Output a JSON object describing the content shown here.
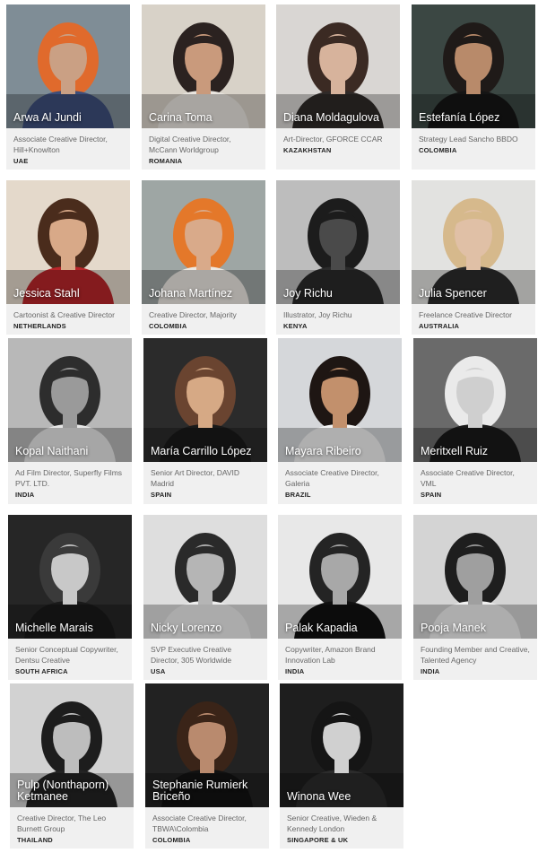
{
  "profiles": [
    {
      "name": "Arwa Al Jundi",
      "role": "Associate Creative Director, Hill+Knowlton",
      "country": "UAE",
      "bg": "#7f8d96",
      "skin": "#caa084",
      "hair": "#e06a2c",
      "shirt": "#3d4e7a"
    },
    {
      "name": "Carina Toma",
      "role": "Digital Creative Director, McCann Worldgroup",
      "country": "ROMANIA",
      "bg": "#d8d2c8",
      "skin": "#c99a7c",
      "hair": "#2b2220",
      "shirt": "#e9e5df"
    },
    {
      "name": "Diana Moldagulova",
      "role": "Art-Director, GFORCE CCAR",
      "country": "KAZAKHSTAN",
      "bg": "#d9d6d3",
      "skin": "#d7b39c",
      "hair": "#3b2a23",
      "shirt": "#2f2a28"
    },
    {
      "name": "Estefanía López",
      "role": "Strategy Lead Sancho BBDO",
      "country": "COLOMBIA",
      "bg": "#3b4743",
      "skin": "#b88a6a",
      "hair": "#1f1a18",
      "shirt": "#151515"
    },
    {
      "name": "Jessica Stahl",
      "role": "Cartoonist & Creative Director",
      "country": "NETHERLANDS",
      "bg": "#e4d9cb",
      "skin": "#d8a988",
      "hair": "#4a2c1c",
      "shirt": "#b8262a"
    },
    {
      "name": "Johana Martínez",
      "role": "Creative Director, Majority",
      "country": "COLOMBIA",
      "bg": "#9ea6a4",
      "skin": "#d9aa8a",
      "hair": "#e4782a",
      "shirt": "#ece8e2"
    },
    {
      "name": "Joy Richu",
      "role": "Illustrator, Joy Richu",
      "country": "KENYA",
      "bg": "#bdbdbd",
      "skin": "#4a4a4a",
      "hair": "#1c1c1c",
      "shirt": "#2a2a2a"
    },
    {
      "name": "Julia Spencer",
      "role": "Freelance Creative Director",
      "country": "AUSTRALIA",
      "bg": "#e2e2e0",
      "skin": "#e0c0a6",
      "hair": "#d6b98c",
      "shirt": "#2b2b2b"
    },
    {
      "name": "Kopal Naithani",
      "role": "Ad Film Director, Superfly Films PVT. LTD.",
      "country": "INDIA",
      "bg": "#b8b8b8",
      "skin": "#9a9a9a",
      "hair": "#2d2d2d",
      "shirt": "#e6e6e6"
    },
    {
      "name": "María Carrillo López",
      "role": "Senior Art Director, DAVID Madrid",
      "country": "SPAIN",
      "bg": "#2b2b2b",
      "skin": "#d6a985",
      "hair": "#6a4430",
      "shirt": "#1a1a1a"
    },
    {
      "name": "Mayara Ribeiro",
      "role": "Associate Creative Director, Galeria",
      "country": "BRAZIL",
      "bg": "#d5d7da",
      "skin": "#c2906c",
      "hair": "#1e1613",
      "shirt": "#f3f3f3"
    },
    {
      "name": "Meritxell Ruiz",
      "role": "Associate Creative Director, VML",
      "country": "SPAIN",
      "bg": "#6a6a6a",
      "skin": "#cfcfcf",
      "hair": "#eaeaea",
      "shirt": "#1a1a1a"
    },
    {
      "name": "Michelle Marais",
      "role": "Senior Conceptual Copywriter, Dentsu Creative",
      "country": "SOUTH AFRICA",
      "bg": "#262626",
      "skin": "#c8c8c8",
      "hair": "#3a3a3a",
      "shirt": "#1a1a1a"
    },
    {
      "name": "Nicky Lorenzo",
      "role": "SVP Executive Creative Director, 305 Worldwide",
      "country": "USA",
      "bg": "#dedede",
      "skin": "#b5b5b5",
      "hair": "#2a2a2a",
      "shirt": "#eeeeee"
    },
    {
      "name": "Palak Kapadia",
      "role": "Copywriter, Amazon Brand Innovation Lab",
      "country": "INDIA",
      "bg": "#e8e8e8",
      "skin": "#a8a8a8",
      "hair": "#242424",
      "shirt": "#111111"
    },
    {
      "name": "Pooja Manek",
      "role": "Founding Member and Creative, Talented Agency",
      "country": "INDIA",
      "bg": "#d4d4d4",
      "skin": "#9f9f9f",
      "hair": "#1e1e1e",
      "shirt": "#f0f0f0"
    },
    {
      "name": "Pulp (Nonthaporn) Ketmanee",
      "role": "Creative Director, The Leo Burnett Group",
      "country": "THAILAND",
      "bg": "#d2d2d2",
      "skin": "#bdbdbd",
      "hair": "#1d1d1d",
      "shirt": "#232323"
    },
    {
      "name": "Stephanie Rumierk Briceño",
      "role": "Associate Creative Director, TBWA\\Colombia",
      "country": "COLOMBIA",
      "bg": "#222222",
      "skin": "#b98a6e",
      "hair": "#3a2418",
      "shirt": "#121212"
    },
    {
      "name": "Winona Wee",
      "role": "Senior Creative, Wieden & Kennedy London",
      "country": "SINGAPORE & UK",
      "bg": "#1e1e1e",
      "skin": "#d0d0d0",
      "hair": "#151515",
      "shirt": "#2c2c2c"
    }
  ]
}
